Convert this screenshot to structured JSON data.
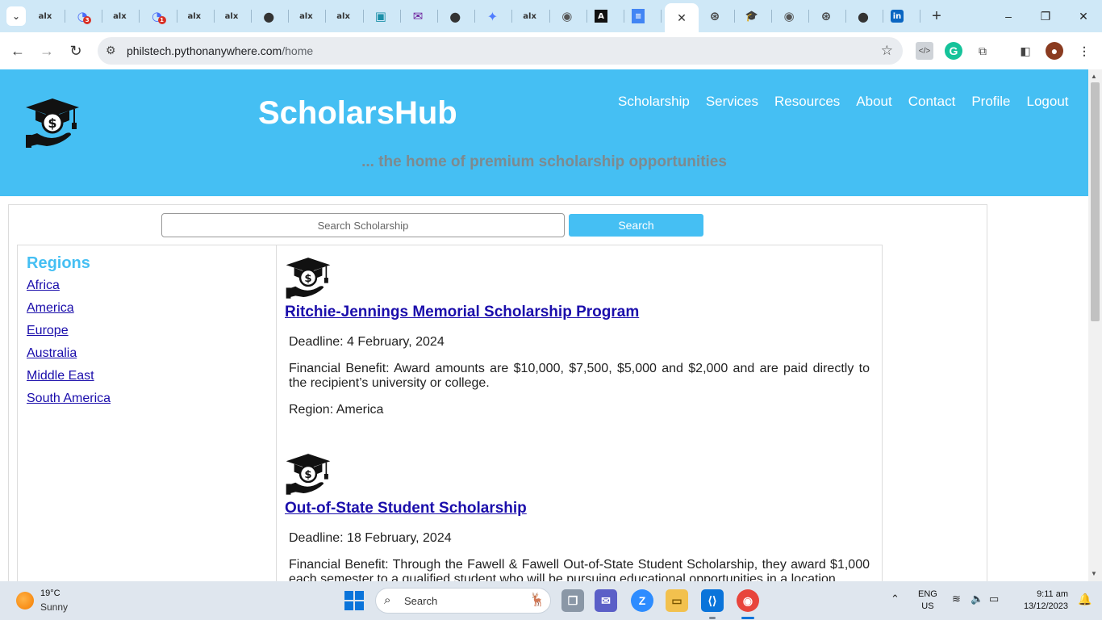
{
  "browser": {
    "tabs": [
      {
        "icon": "alx-icon",
        "label": "alx"
      },
      {
        "icon": "gmail-badge-icon",
        "label": "",
        "badge": "3"
      },
      {
        "icon": "alx-icon",
        "label": "alx"
      },
      {
        "icon": "gmail-badge-icon",
        "label": "",
        "badge": "1"
      },
      {
        "icon": "alx-icon",
        "label": "alx"
      },
      {
        "icon": "alx-icon",
        "label": "alx"
      },
      {
        "icon": "github-icon",
        "label": ""
      },
      {
        "icon": "alx-icon",
        "label": "alx"
      },
      {
        "icon": "alx-icon",
        "label": "alx"
      },
      {
        "icon": "app-icon",
        "label": ""
      },
      {
        "icon": "mail-icon",
        "label": ""
      },
      {
        "icon": "github-icon",
        "label": ""
      },
      {
        "icon": "gemini-icon",
        "label": ""
      },
      {
        "icon": "alx-icon",
        "label": "alx"
      },
      {
        "icon": "circle-icon",
        "label": ""
      },
      {
        "icon": "a-icon",
        "label": ""
      },
      {
        "icon": "docs-icon",
        "label": ""
      }
    ],
    "tabs_after_active": [
      {
        "icon": "openai-icon",
        "label": ""
      },
      {
        "icon": "scholar-icon",
        "label": ""
      },
      {
        "icon": "cc-icon",
        "label": ""
      },
      {
        "icon": "openai-icon",
        "label": ""
      },
      {
        "icon": "github-icon",
        "label": ""
      },
      {
        "icon": "linkedin-icon",
        "label": ""
      }
    ],
    "url_host": "philstech.pythonanywhere.com",
    "url_path": "/home"
  },
  "site": {
    "title": "ScholarsHub",
    "tagline": "... the home of premium scholarship opportunities",
    "nav": [
      "Scholarship",
      "Services",
      "Resources",
      "About",
      "Contact",
      "Profile",
      "Logout"
    ]
  },
  "search": {
    "placeholder": "Search Scholarship",
    "button_label": "Search"
  },
  "regions": {
    "heading": "Regions",
    "items": [
      "Africa",
      "America",
      "Europe",
      "Australia",
      "Middle East",
      "South America"
    ]
  },
  "scholarships": [
    {
      "title": "Ritchie-Jennings Memorial Scholarship Program",
      "deadline": "Deadline: 4 February, 2024",
      "benefit": "Financial Benefit: Award amounts are $10,000, $7,500, $5,000 and $2,000 and are paid directly to the recipient’s university or college.",
      "region": "Region: America"
    },
    {
      "title": "Out-of-State Student Scholarship",
      "deadline": "Deadline: 18 February, 2024",
      "benefit": "Financial Benefit: Through the Fawell & Fawell Out-of-State Student Scholarship, they award $1,000 each semester to a qualified student who will be pursuing educational opportunities in a location",
      "region": ""
    }
  ],
  "taskbar": {
    "temperature": "19°C",
    "condition": "Sunny",
    "search_label": "Search",
    "lang_top": "ENG",
    "lang_bottom": "US",
    "time": "9:11 am",
    "date": "13/12/2023"
  },
  "colors": {
    "brand": "#45bff3",
    "tagline": "#7d8a8f",
    "link": "#1a0dab"
  }
}
